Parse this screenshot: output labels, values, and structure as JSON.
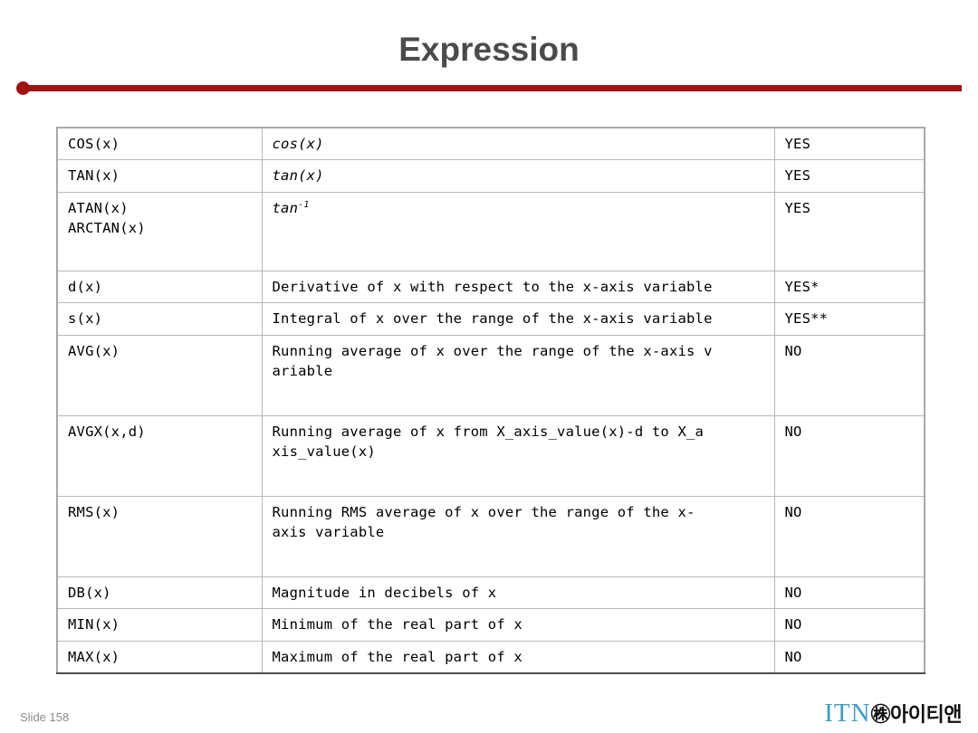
{
  "slide": {
    "title": "Expression",
    "slide_number": "Slide 158",
    "accent_color": "#9e1212",
    "title_color": "#4b4b4b"
  },
  "logo": {
    "brand_latin": "ITN",
    "brand_korean": "㊑아이티앤",
    "brand_latin_color": "#3d9cc7",
    "brand_korean_color": "#111111"
  },
  "table": {
    "columns": [
      "name",
      "description",
      "plottable"
    ],
    "rows": [
      {
        "name": "COS(x)",
        "description": "cos(x)",
        "description_style": "italic",
        "plottable": "YES"
      },
      {
        "name": "TAN(x)",
        "description": "tan(x)",
        "description_style": "italic",
        "plottable": "YES"
      },
      {
        "name": "ATAN(x)",
        "name_line2": "ARCTAN(x)",
        "description": "tan",
        "description_superscript": "-1",
        "description_style": "italic",
        "plottable": "YES"
      },
      {
        "name": "d(x)",
        "description": "Derivative of x with respect to the x-axis variable",
        "plottable": "YES*"
      },
      {
        "name": "s(x)",
        "description": "Integral of x over the range of the x-axis variable",
        "plottable": "YES**"
      },
      {
        "name": "AVG(x)",
        "description": "Running average of x over the range of the x-axis v",
        "description_line2": "ariable",
        "plottable": "NO"
      },
      {
        "name": "AVGX(x,d)",
        "description": "Running average of x from X_axis_value(x)-d to X_a",
        "description_line2": "xis_value(x)",
        "plottable": "NO"
      },
      {
        "name": "RMS(x)",
        "description": "Running RMS average of x over the range of the x-",
        "description_line2": "axis variable",
        "plottable": "NO"
      },
      {
        "name": "DB(x)",
        "description": "Magnitude in decibels of x",
        "plottable": "NO"
      },
      {
        "name": "MIN(x)",
        "description": "Minimum of the real part of x",
        "plottable": "NO"
      },
      {
        "name": "MAX(x)",
        "description": "Maximum of the real part of x",
        "plottable": "NO"
      }
    ]
  }
}
